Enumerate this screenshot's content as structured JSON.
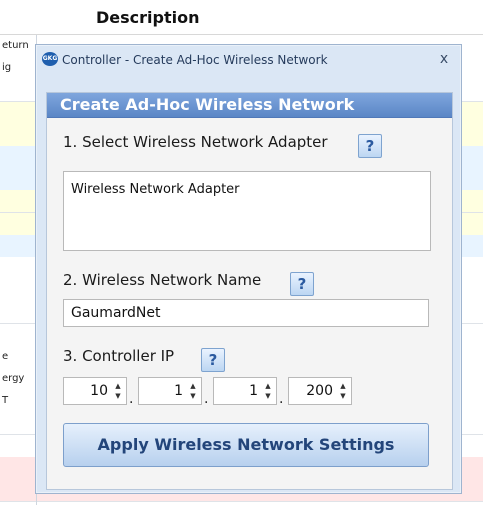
{
  "background": {
    "header": "Description",
    "row_fragments": [
      "eturn",
      "ig",
      "",
      "",
      "",
      "",
      "",
      "",
      "",
      "",
      "",
      "",
      "",
      "",
      "e",
      "ergy",
      "T",
      "",
      "",
      "",
      ""
    ],
    "row_colors": [
      "#ffffff",
      "#ffffff",
      "#ffffff",
      "#ffffe0",
      "#ffffe0",
      "#e8f4ff",
      "#e8f4ff",
      "#ffffe0",
      "#ffffe0",
      "#e8f4ff",
      "#ffffff",
      "#ffffff",
      "#ffffff",
      "#ffffff",
      "#ffffff",
      "#ffffff",
      "#ffffff",
      "#ffffff",
      "#ffffff",
      "#ffe6e6",
      "#ffe6e6"
    ]
  },
  "dialog": {
    "icon_text": "GKG",
    "title": "Controller - Create Ad-Hoc Wireless Network",
    "close_label": "x",
    "header": "Create Ad-Hoc Wireless Network",
    "step1": {
      "label": "1. Select Wireless Network Adapter",
      "help": "?",
      "items": [
        "Wireless Network Adapter"
      ]
    },
    "step2": {
      "label": "2. Wireless Network Name",
      "help": "?",
      "value": "GaumardNet"
    },
    "step3": {
      "label": "3. Controller IP",
      "help": "?",
      "octets": [
        "10",
        "1",
        "1",
        "200"
      ],
      "separator": "."
    },
    "apply_label": "Apply Wireless Network Settings"
  },
  "colors": {
    "header_blue": "#5a86c6",
    "dialog_bg": "#dbe7f5",
    "button_text": "#23457a"
  }
}
